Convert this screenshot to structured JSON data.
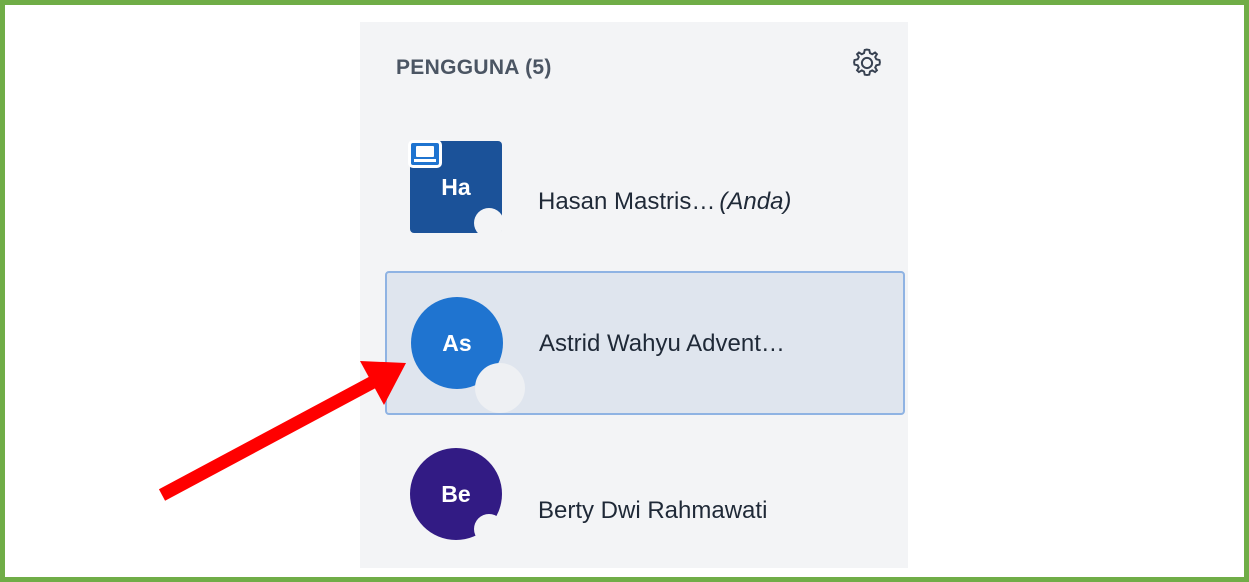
{
  "panel": {
    "title": "PENGGUNA (5)",
    "settings_icon": "gear-icon"
  },
  "users": [
    {
      "initials": "Ha",
      "name": "Hasan Mastris…",
      "tag": "(Anda)",
      "avatar_color": "#1b5299",
      "shape": "square",
      "presenter": true
    },
    {
      "initials": "As",
      "name": "Astrid Wahyu Advent…",
      "avatar_color": "#1f74d0",
      "shape": "circle",
      "selected": true
    },
    {
      "initials": "Be",
      "name": "Berty Dwi Rahmawati",
      "avatar_color": "#321b84",
      "shape": "circle"
    }
  ],
  "colors": {
    "frame_border": "#70ad47",
    "annotation_arrow": "#ff0000",
    "selected_row_border": "#8fb3e3"
  }
}
